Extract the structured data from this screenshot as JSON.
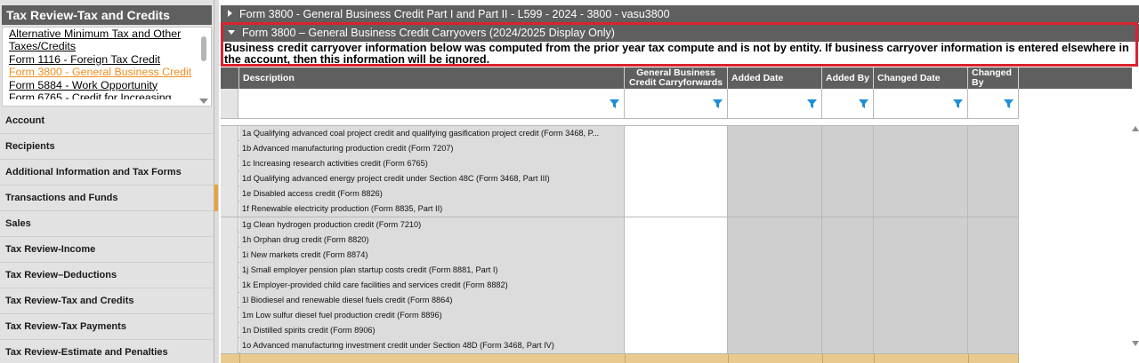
{
  "left_panel": {
    "header": "Tax Review-Tax and Credits",
    "links": [
      {
        "label": "Alternative Minimum Tax and Other Taxes/Credits",
        "active": false
      },
      {
        "label": "Form 1116 - Foreign Tax Credit",
        "active": false
      },
      {
        "label": "Form 3800 - General Business Credit",
        "active": true
      },
      {
        "label": "Form 5884 - Work Opportunity",
        "active": false
      },
      {
        "label": "Form 6765 - Credit for Increasing",
        "active": false
      }
    ],
    "nav": [
      "Account",
      "Recipients",
      "Additional Information and Tax Forms",
      "Transactions and Funds",
      "Sales",
      "Tax Review-Income",
      "Tax Review–Deductions",
      "Tax Review-Tax and Credits",
      "Tax Review-Tax Payments",
      "Tax Review-Estimate and Penalties"
    ]
  },
  "sections": {
    "collapsed_title": "Form 3800 - General Business Credit Part I and Part II  - L599 - 2024 - 3800 - vasu3800",
    "expanded_title": "Form 3800 – General Business Credit Carryovers (2024/2025 Display Only)",
    "notice": "Business credit carryover information below was computed from the prior year tax compute and is not by entity. If business carryover information is entered elsewhere in the account, then this information will be ignored."
  },
  "grid": {
    "columns": {
      "description": "Description",
      "carryforwards": "General Business Credit Carryforwards",
      "added_date": "Added Date",
      "added_by": "Added By",
      "changed_date": "Changed Date",
      "changed_by": "Changed By"
    },
    "rows": [
      "1a  Qualifying advanced coal project credit and qualifying gasification project credit (Form 3468, P...",
      "1b  Advanced manufacturing production credit (Form 7207)",
      "1c  Increasing research activities credit (Form 6765)",
      "1d  Qualifying advanced energy project credit under Section 48C  (Form 3468, Part III)",
      "1e  Disabled access credit (Form 8826)",
      "1f  Renewable electricity production (Form 8835, Part II)",
      "1g  Clean hydrogen production credit (Form 7210)",
      "1h  Orphan drug credit (Form 8820)",
      "1i  New markets credit (Form 8874)",
      "1j  Small employer pension plan startup costs credit (Form 8881, Part I)",
      "1k  Employer-provided child care facilities and services credit (Form 8882)",
      "1l  Biodiesel and renewable diesel fuels credit  (Form 8864)",
      "1m  Low sulfur diesel fuel production credit (Form 8896)",
      "1n  Distilled spirits credit (Form 8906)",
      "1o  Advanced manufacturing investment credit under Section 48D (Form 3468, Part IV)"
    ]
  },
  "colors": {
    "header_bg": "#5f5f5f",
    "active_link": "#f28c1b",
    "highlight_border": "#d9232d",
    "filter_icon": "#1e8fd6",
    "total_row": "#e9c98d"
  },
  "icons": [
    "filter-funnel-icon",
    "expand-triangle-icon",
    "collapse-triangle-icon"
  ]
}
